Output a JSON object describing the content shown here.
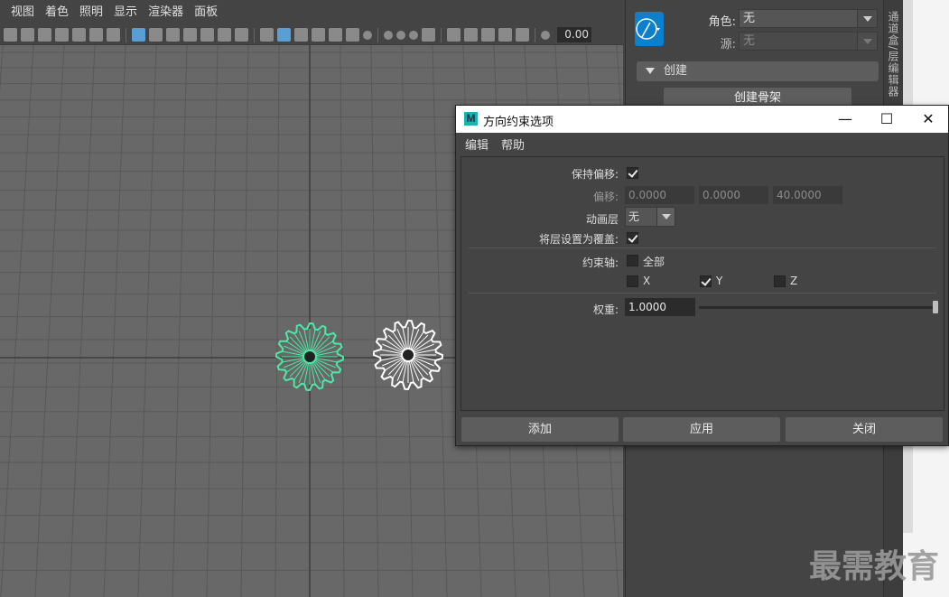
{
  "viewport": {
    "menu": [
      "视图",
      "着色",
      "照明",
      "显示",
      "渲染器",
      "面板"
    ],
    "toolbar_value": "0.00",
    "objects": [
      "gear-selected",
      "gear-wireframe"
    ]
  },
  "right_panel": {
    "character_label": "角色:",
    "character_value": "无",
    "source_label": "源:",
    "source_value": "无",
    "section_create": "创建",
    "create_skeleton_button": "创建骨架",
    "side_tab": "通道盒/层编辑器"
  },
  "watermark": "最需教育",
  "dialog": {
    "title": "方向约束选项",
    "app_icon": "M",
    "menu": [
      "编辑",
      "帮助"
    ],
    "window_buttons": {
      "minimize": "—",
      "maximize": "☐",
      "close": "✕"
    },
    "form": {
      "maintain_offset_label": "保持偏移:",
      "maintain_offset_checked": true,
      "offset_label": "偏移:",
      "offset_values": [
        "0.0000",
        "0.0000",
        "40.0000"
      ],
      "anim_layer_label": "动画层",
      "anim_layer_value": "无",
      "set_layer_override_label": "将层设置为覆盖:",
      "set_layer_override_checked": true,
      "constraint_axes_label": "约束轴:",
      "axis_all_label": "全部",
      "axis_x_label": "X",
      "axis_y_label": "Y",
      "axis_z_label": "Z",
      "axis_all_checked": false,
      "axis_x_checked": false,
      "axis_y_checked": true,
      "axis_z_checked": false,
      "weight_label": "权重:",
      "weight_value": "1.0000",
      "weight_slider_level": 1.0
    },
    "buttons": {
      "add": "添加",
      "apply": "应用",
      "close": "关闭"
    }
  },
  "colors": {
    "viewport_bg": "#686868",
    "grid_line": "#585858",
    "selected_object": "#4ee8a6",
    "wireframe_object": "#ffffff",
    "accent_blue": "#0c7fcd"
  }
}
